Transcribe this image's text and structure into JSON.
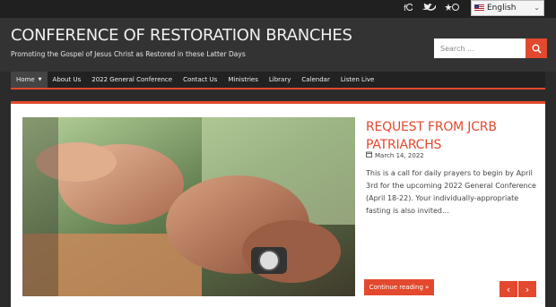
{
  "topbar": {
    "social_icons": [
      "facebook-icon",
      "twitter-icon",
      "star-icon"
    ],
    "language": {
      "selected": "English"
    }
  },
  "header": {
    "site_title": "CONFERENCE OF RESTORATION BRANCHES",
    "tagline": "Promoting the Gospel of Jesus Christ as Restored in these Latter Days",
    "search_placeholder": "Search ..."
  },
  "nav": {
    "items": [
      {
        "label": "Home",
        "active": true,
        "dropdown": true
      },
      {
        "label": "About Us"
      },
      {
        "label": "2022 General Conference"
      },
      {
        "label": "Contact Us"
      },
      {
        "label": "Ministries"
      },
      {
        "label": "Library"
      },
      {
        "label": "Calendar"
      },
      {
        "label": "Listen Live"
      }
    ]
  },
  "post": {
    "title": "REQUEST FROM JCRB PATRIARCHS",
    "date": "March 14, 2022",
    "excerpt": "This is a call for daily prayers to begin by April 3rd for the upcoming 2022 General Conference (April 18-22). Your individually-appropriate fasting is also invited...",
    "continue_label": "Continue reading »",
    "prev_label": "‹",
    "next_label": "›"
  },
  "colors": {
    "accent": "#e2492e",
    "topbar": "#202020",
    "header": "#333333",
    "nav": "#222222"
  }
}
